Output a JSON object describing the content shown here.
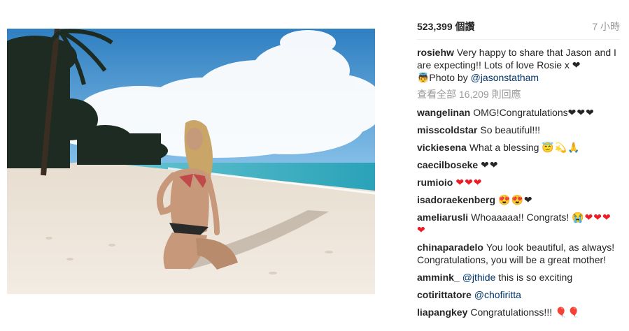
{
  "post": {
    "likes_label": "523,399 個讚",
    "time_label": "7 小時",
    "caption": {
      "user": "rosiehw",
      "text_a": "Very happy to share that Jason and I are expecting!! Lots of love Rosie x ❤",
      "text_b": "👼Photo by ",
      "mention": "@jasonstatham"
    },
    "view_all_label": "查看全部 16,209 則回應"
  },
  "comments": [
    {
      "user": "wangelinan",
      "text": "OMG!Congratulations",
      "emoji": "❤❤❤"
    },
    {
      "user": "misscoldstar",
      "text": "So beautiful!!!",
      "emoji": ""
    },
    {
      "user": "vickiesena",
      "text": "What a blessing",
      "emoji": "😇💫🙏"
    },
    {
      "user": "caecilboseke",
      "text": "",
      "emoji": "❤❤"
    },
    {
      "user": "rumioio",
      "text": "",
      "emoji": "❤❤❤"
    },
    {
      "user": "isadoraekenberg",
      "text": "",
      "emoji": "😍😍❤"
    },
    {
      "user": "ameliarusli",
      "text": "Whoaaaaa!! Congrats!",
      "emoji": "😭❤❤❤❤"
    },
    {
      "user": "chinaparadelo",
      "text": "You look beautiful, as always! Congratulations, you will be a great mother!",
      "emoji": ""
    },
    {
      "user": "ammink_",
      "mention": "@jthide",
      "text": " this is so exciting",
      "emoji": ""
    },
    {
      "user": "cotirittatore",
      "mention": "@chofiritta",
      "text": "",
      "emoji": ""
    },
    {
      "user": "liapangkey",
      "text": "Congratulationss!!!",
      "emoji": "🎈🎈"
    }
  ],
  "colors": {
    "sky_top": "#2f7fc1",
    "sky_bottom": "#7fbbe6",
    "sea": "#3fb3c4",
    "sand": "#efe6da",
    "link": "#003569",
    "muted": "#999999"
  },
  "photo": {
    "icon": "photo-image"
  }
}
